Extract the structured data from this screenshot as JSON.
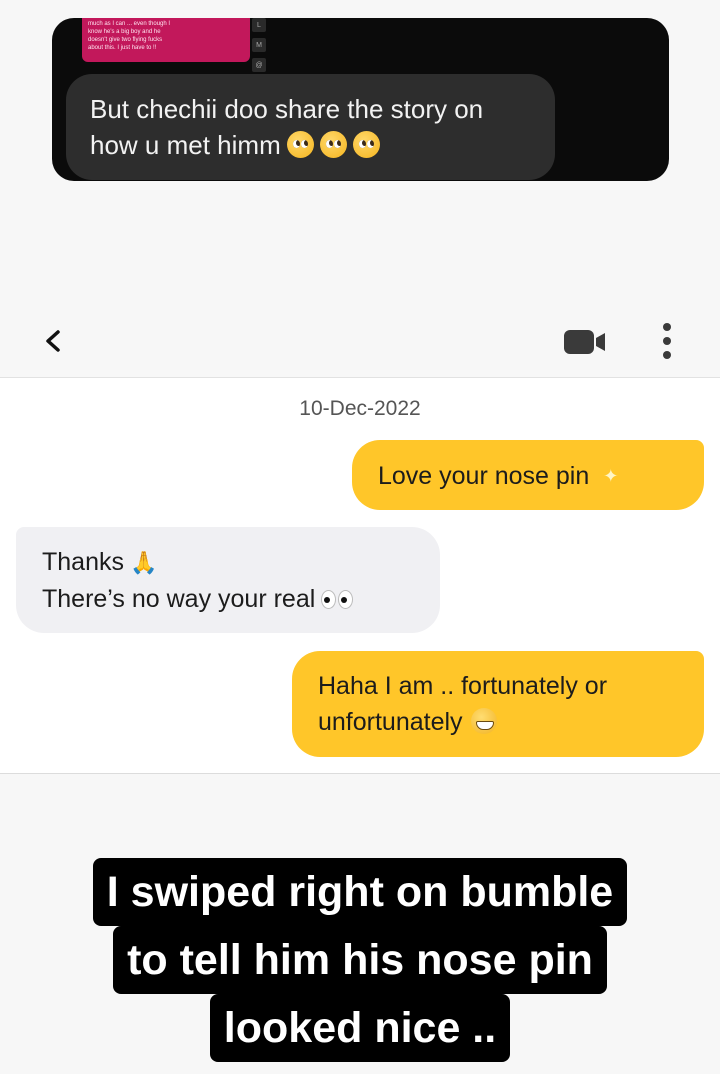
{
  "story_card": {
    "thumbnail_text": [
      "much as I can ... even though I",
      "know he's a big boy and he",
      "doesn't give two flying fucks",
      "about this. I just have to !!"
    ],
    "mini_keys": [
      "L",
      "M",
      "@"
    ],
    "message": "But chechii doo share the story on how u met himm"
  },
  "chat": {
    "date": "10-Dec-2022",
    "messages": [
      {
        "side": "out",
        "lines": [
          "Love your nose pin"
        ]
      },
      {
        "side": "in",
        "lines": [
          "Thanks",
          "There’s no way your real"
        ]
      },
      {
        "side": "out",
        "lines": [
          "Haha I am .. fortunately or",
          "unfortunately"
        ]
      }
    ]
  },
  "caption": {
    "lines": [
      "I swiped right on bumble",
      "to tell him his nose pin",
      "looked nice .."
    ]
  },
  "colors": {
    "accent_yellow": "#ffc629",
    "incoming_bubble": "#f0f0f3",
    "story_bg": "#0b0b0b",
    "story_bubble": "#2d2d2d"
  },
  "icons": [
    "back-arrow-icon",
    "video-call-icon",
    "more-options-icon",
    "pleading-face-emoji",
    "sparkles-emoji",
    "folded-hands-emoji",
    "eyes-emoji",
    "grinning-face-emoji"
  ]
}
